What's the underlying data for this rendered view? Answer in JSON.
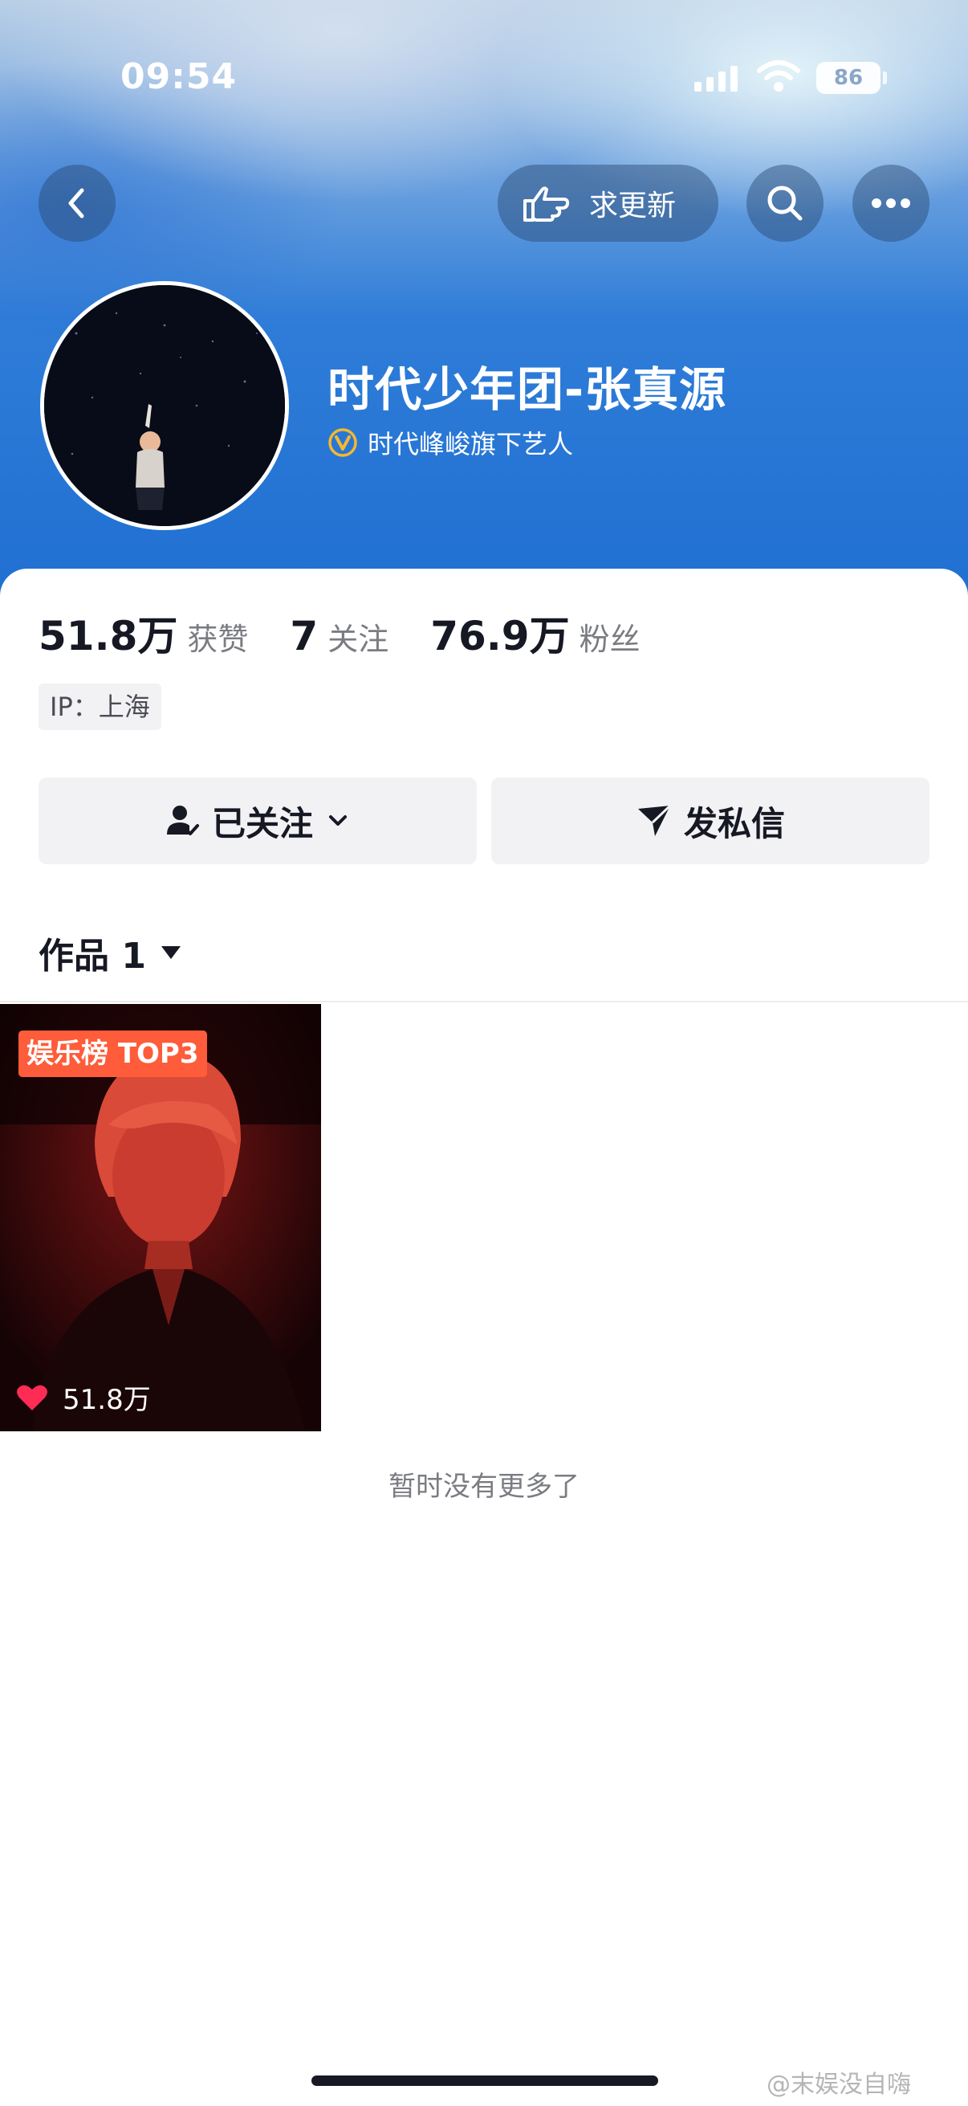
{
  "status_bar": {
    "time": "09:54",
    "battery": "86"
  },
  "nav": {
    "back_icon": "chevron-left-icon",
    "update_label": "求更新",
    "update_icon": "pointing-hand-icon",
    "search_icon": "search-icon",
    "more_icon": "more-dots-icon"
  },
  "profile": {
    "name": "时代少年团-张真源",
    "verified_text": "时代峰峻旗下艺人",
    "verified_icon": "verified-v-icon"
  },
  "stats": [
    {
      "value": "51.8万",
      "label": "获赞"
    },
    {
      "value": "7",
      "label": "关注"
    },
    {
      "value": "76.9万",
      "label": "粉丝"
    }
  ],
  "ip_tag": "IP：上海",
  "actions": {
    "follow_label": "已关注",
    "message_label": "发私信"
  },
  "works": {
    "tab_label": "作品 1",
    "items": [
      {
        "badge": "娱乐榜 TOP3",
        "likes": "51.8万"
      }
    ],
    "end_text": "暂时没有更多了"
  },
  "watermark": "@末娱没自嗨",
  "colors": {
    "badge": "#fe5c3a",
    "heart": "#fe2c55",
    "verify": "#f5b82e"
  }
}
